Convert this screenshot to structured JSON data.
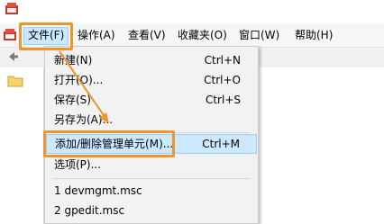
{
  "menubar": {
    "items": [
      {
        "label": "文件(F)"
      },
      {
        "label": "操作(A)"
      },
      {
        "label": "查看(V)"
      },
      {
        "label": "收藏夹(O)"
      },
      {
        "label": "窗口(W)"
      },
      {
        "label": "帮助(H)"
      }
    ]
  },
  "file_menu": {
    "items": [
      {
        "label": "新建(N)",
        "shortcut": "Ctrl+N"
      },
      {
        "label": "打开(O)...",
        "shortcut": "Ctrl+O"
      },
      {
        "label": "保存(S)",
        "shortcut": "Ctrl+S"
      },
      {
        "label": "另存为(A)..."
      },
      {
        "label": "添加/删除管理单元(M)...",
        "shortcut": "Ctrl+M",
        "highlighted": true
      },
      {
        "label": "选项(P)..."
      },
      {
        "label": "1 devmgmt.msc"
      },
      {
        "label": "2 gpedit.msc"
      }
    ]
  },
  "annotation": {
    "color": "#f0932b"
  },
  "icons": {
    "app": "mmc-app-icon",
    "back": "back-arrow-icon",
    "folder": "folder-icon"
  }
}
